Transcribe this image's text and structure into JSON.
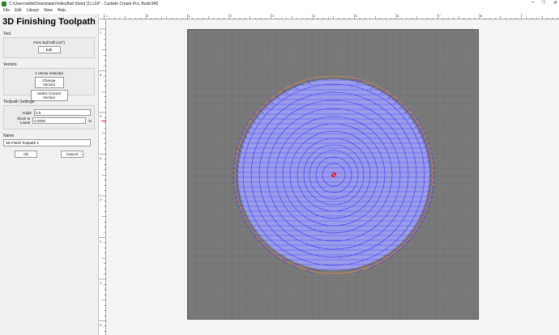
{
  "window": {
    "title": "C:\\Users\\willa\\Downloads\\VolleyBall Stand (1).c2d* - Carbide Create Pro, Build 845",
    "min": "–",
    "max": "□",
    "close": "✕"
  },
  "menu": [
    "File",
    "Edit",
    "Library",
    "View",
    "Help"
  ],
  "panel": {
    "title": "3D Finishing Toolpath",
    "tool_section": "Tool",
    "tool_name": "#101 Ball Mill (1/8\")",
    "edit_label": "Edit",
    "vectors_section": "Vectors",
    "vectors_selected": "1 Vector selected",
    "change_vectors_label": "Change Vectors",
    "select_current_label": "Select Current Vectors",
    "settings_section": "Toolpath Settings",
    "angle_label": "Angle",
    "angle_value": "0.0",
    "stock_label": "Stock to Leave",
    "stock_value": "0.0000",
    "stock_unit": "in",
    "name_section": "Name",
    "name_value": "3D Finish Toolpath 1",
    "ok_label": "Ok",
    "cancel_label": "Cancel"
  },
  "ruler": {
    "top_ticks": [
      "-1",
      "0",
      "1",
      "2",
      "3",
      "4",
      "5",
      "6",
      "7",
      "8"
    ],
    "left_ticks": [
      "7",
      "6",
      "5",
      "4",
      "3",
      "2",
      "1",
      "0"
    ]
  },
  "colors": {
    "toolpath": "#3b3bf0",
    "fill": "#8a8ae6",
    "boundary": "#ff8a4a",
    "origin": "#e0102a",
    "stock": "#7a7a7a"
  }
}
